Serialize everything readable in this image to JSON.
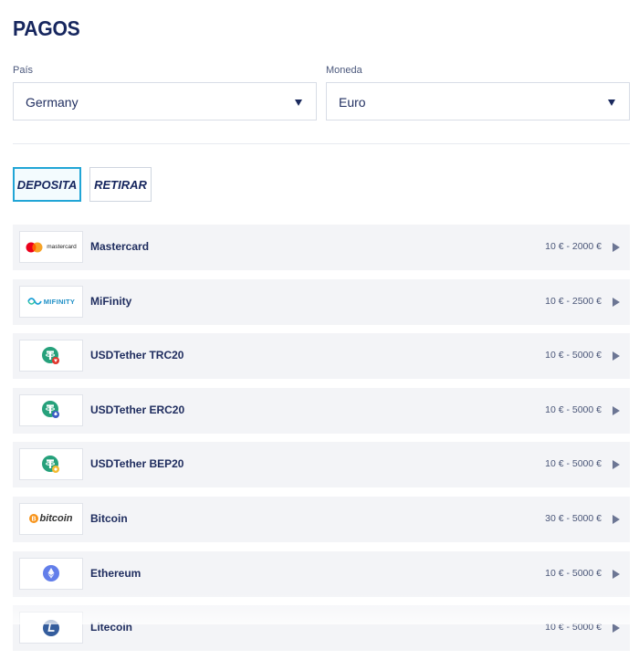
{
  "page": {
    "title": "PAGOS"
  },
  "filters": {
    "country": {
      "label": "País",
      "value": "Germany"
    },
    "currency": {
      "label": "Moneda",
      "value": "Euro"
    }
  },
  "tabs": [
    {
      "label": "DEPOSITA",
      "active": true
    },
    {
      "label": "RETIRAR",
      "active": false
    }
  ],
  "methods": [
    {
      "name": "Mastercard",
      "range": "10 € - 2000 €",
      "logo": "mastercard-logo",
      "logo_text": "mastercard"
    },
    {
      "name": "MiFinity",
      "range": "10 € - 2500 €",
      "logo": "mifinity-logo",
      "logo_text": "MIFINITY"
    },
    {
      "name": "USDTether TRC20",
      "range": "10 € - 5000 €",
      "logo": "tether-trc20-logo",
      "logo_text": ""
    },
    {
      "name": "USDTether ERC20",
      "range": "10 € - 5000 €",
      "logo": "tether-erc20-logo",
      "logo_text": ""
    },
    {
      "name": "USDTether BEP20",
      "range": "10 € - 5000 €",
      "logo": "tether-bep20-logo",
      "logo_text": ""
    },
    {
      "name": "Bitcoin",
      "range": "30 € - 5000 €",
      "logo": "bitcoin-logo",
      "logo_text": "bitcoin"
    },
    {
      "name": "Ethereum",
      "range": "10 € - 5000 €",
      "logo": "ethereum-logo",
      "logo_text": ""
    },
    {
      "name": "Litecoin",
      "range": "10 € - 5000 €",
      "logo": "litecoin-logo",
      "logo_text": ""
    }
  ],
  "colors": {
    "primary_text": "#16265e",
    "tab_active_border": "#21a5d6",
    "row_background": "#f3f4f7",
    "tether": "#26a17b",
    "bitcoin": "#f7931a",
    "ethereum": "#627eea",
    "mastercard_red": "#eb001b",
    "mastercard_yellow": "#f79e1b",
    "mifinity": "#1e9fd6"
  }
}
